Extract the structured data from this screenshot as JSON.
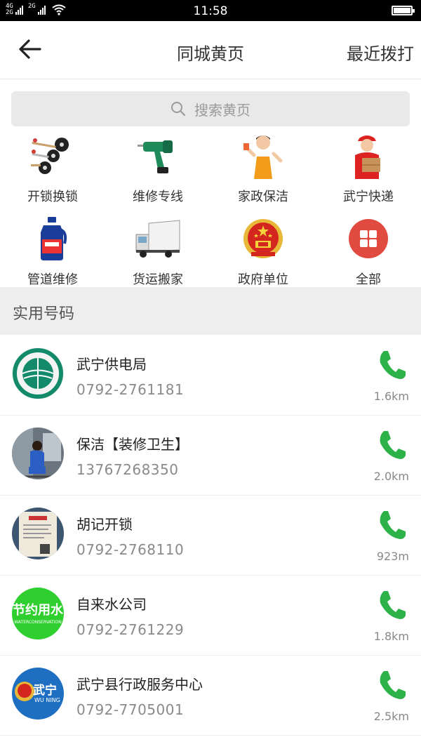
{
  "status_bar": {
    "network_top": "4G",
    "network_bottom": "2G",
    "network2_top": "2G",
    "time": "11:58"
  },
  "header": {
    "title": "同城黄页",
    "recent_calls": "最近拨打"
  },
  "search": {
    "placeholder": "搜索黄页"
  },
  "categories": [
    {
      "label": "开锁换锁",
      "icon": "key-icon"
    },
    {
      "label": "维修专线",
      "icon": "drill-icon"
    },
    {
      "label": "家政保洁",
      "icon": "housekeeper-icon"
    },
    {
      "label": "武宁快递",
      "icon": "courier-icon"
    },
    {
      "label": "管道维修",
      "icon": "pipe-cleaner-icon"
    },
    {
      "label": "货运搬家",
      "icon": "truck-icon"
    },
    {
      "label": "政府单位",
      "icon": "national-emblem-icon"
    },
    {
      "label": "全部",
      "icon": "grid-icon"
    }
  ],
  "section": {
    "title": "实用号码"
  },
  "contacts": [
    {
      "name": "武宁供电局",
      "phone": "0792-2761181",
      "distance": "1.6km"
    },
    {
      "name": "保洁【装修卫生】",
      "phone": "13767268350",
      "distance": "2.0km"
    },
    {
      "name": "胡记开锁",
      "phone": "0792-2768110",
      "distance": "923m"
    },
    {
      "name": "自来水公司",
      "phone": "0792-2761229",
      "distance": "1.8km",
      "logo_text": "节约用水",
      "logo_subtext": "WATERCONSERVATION"
    },
    {
      "name": "武宁县行政服务中心",
      "phone": "0792-7705001",
      "distance": "2.5km",
      "logo_text": "武宁",
      "logo_subtext": "WU NING"
    }
  ],
  "colors": {
    "call_green": "#2db24a",
    "all_red": "#e14a3f"
  }
}
